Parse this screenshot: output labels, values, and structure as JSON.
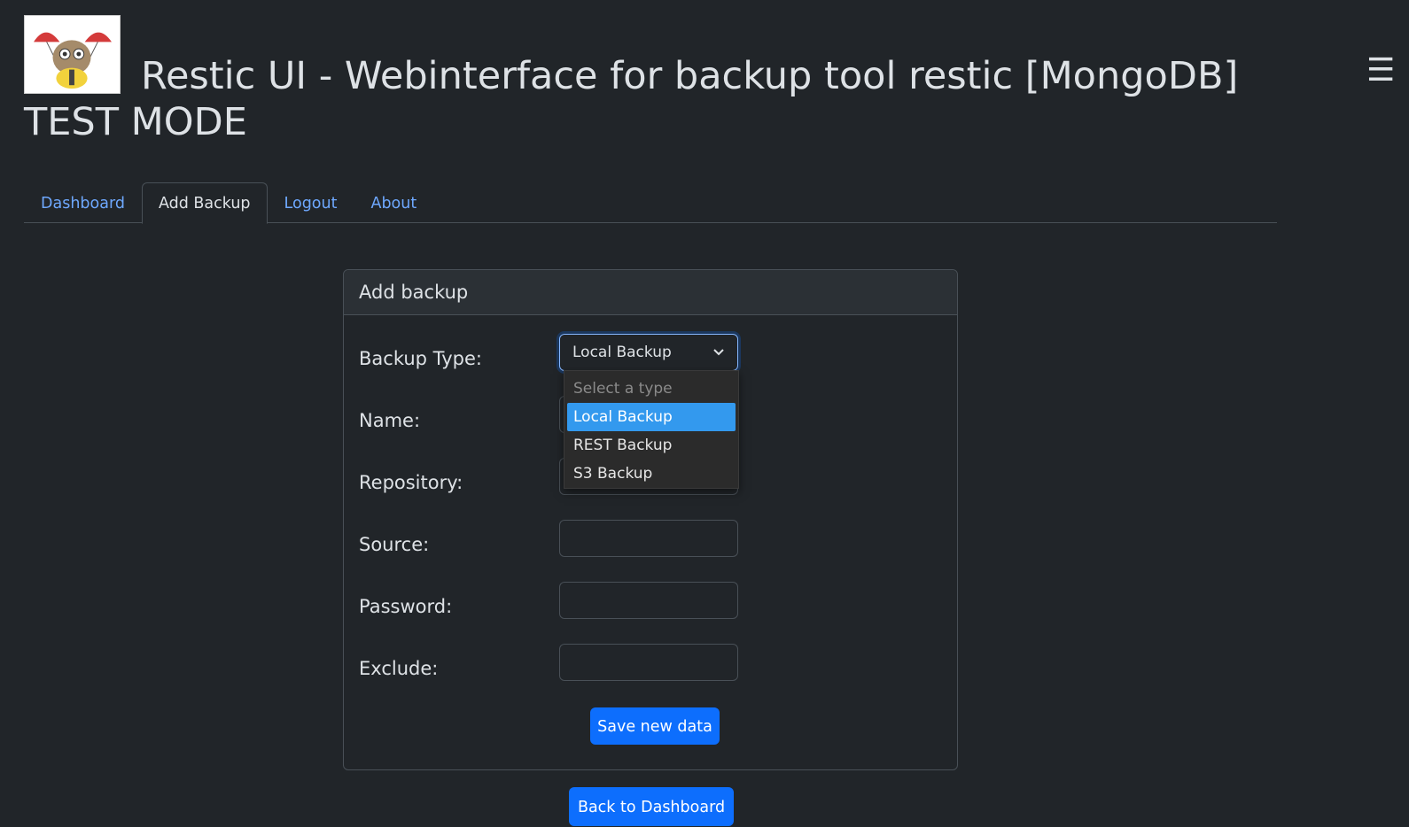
{
  "header": {
    "title": "Restic UI - Webinterface for backup tool restic [MongoDB] TEST MODE",
    "logo_icon": "gopher-parachute-logo",
    "menu_icon": "hamburger-menu-icon"
  },
  "tabs": [
    {
      "label": "Dashboard",
      "active": false
    },
    {
      "label": "Add Backup",
      "active": true
    },
    {
      "label": "Logout",
      "active": false
    },
    {
      "label": "About",
      "active": false
    }
  ],
  "form": {
    "card_title": "Add backup",
    "labels": {
      "backup_type": "Backup Type:",
      "name": "Name:",
      "repository": "Repository:",
      "source": "Source:",
      "password": "Password:",
      "exclude": "Exclude:"
    },
    "backup_type_value": "Local Backup",
    "dropdown_options": [
      {
        "label": "Select a type",
        "placeholder": true
      },
      {
        "label": "Local Backup",
        "selected": true
      },
      {
        "label": "REST Backup"
      },
      {
        "label": "S3 Backup"
      }
    ],
    "save_label": "Save new data"
  },
  "back_label": "Back to Dashboard",
  "colors": {
    "background": "#212529",
    "link": "#6ea8fe",
    "primary_button": "#0d6efd",
    "dropdown_selected": "#3399ee"
  }
}
